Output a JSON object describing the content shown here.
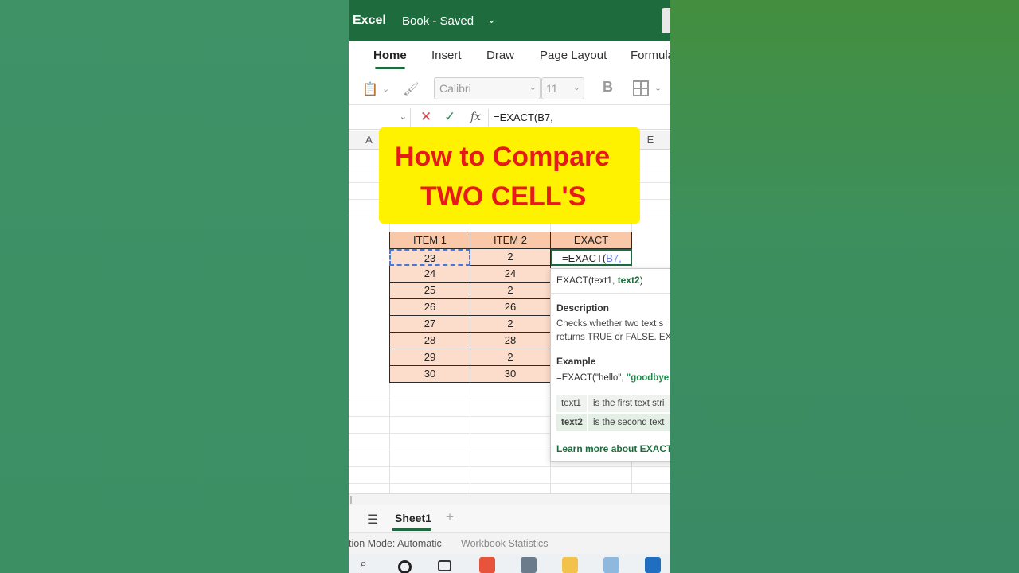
{
  "app": {
    "name": "Excel",
    "document": "Book - Saved"
  },
  "ribbon": {
    "tabs": [
      {
        "label": "Home",
        "active": true
      },
      {
        "label": "Insert",
        "active": false
      },
      {
        "label": "Draw",
        "active": false
      },
      {
        "label": "Page Layout",
        "active": false
      },
      {
        "label": "Formula",
        "active": false
      }
    ],
    "font_name": "Calibri",
    "font_size": "11",
    "bold_label": "B"
  },
  "formula_bar": {
    "fx_label": "fx",
    "text": "=EXACT(B7,"
  },
  "columns": {
    "a": "A",
    "e": "E"
  },
  "banner": {
    "line1": "How to Compare",
    "line2": "TWO CELL'S"
  },
  "table": {
    "headers": [
      "ITEM 1",
      "ITEM 2",
      "EXACT"
    ],
    "rows": [
      [
        "23",
        "2"
      ],
      [
        "24",
        "24"
      ],
      [
        "25",
        "2"
      ],
      [
        "26",
        "26"
      ],
      [
        "27",
        "2"
      ],
      [
        "28",
        "28"
      ],
      [
        "29",
        "2"
      ],
      [
        "30",
        "30"
      ]
    ],
    "active_formula_prefix": "=EXACT(",
    "active_formula_ref": "B7,"
  },
  "tooltip": {
    "sig_fn": "EXACT(text1, ",
    "sig_arg": "text2",
    "sig_close": ")",
    "desc_title": "Description",
    "desc_line1": "Checks whether two text s",
    "desc_line2": "returns TRUE or FALSE. EX",
    "example_title": "Example",
    "example_prefix": "=EXACT(\"hello\", ",
    "example_str": "\"goodbye",
    "args": [
      {
        "name": "text1",
        "desc": "is the first text stri"
      },
      {
        "name": "text2",
        "desc": "is the second text"
      }
    ],
    "learn_more": "Learn more about EXACT"
  },
  "sheets": {
    "active": "Sheet1",
    "add": "+"
  },
  "status": {
    "calc": "tion Mode: Automatic",
    "stats": "Workbook Statistics"
  },
  "colors": {
    "excel_green": "#1e6b3e",
    "banner_yellow": "#fff200",
    "banner_red": "#e8191b",
    "header_fill": "#f8c8a8",
    "cell_fill": "#fcdccb"
  }
}
